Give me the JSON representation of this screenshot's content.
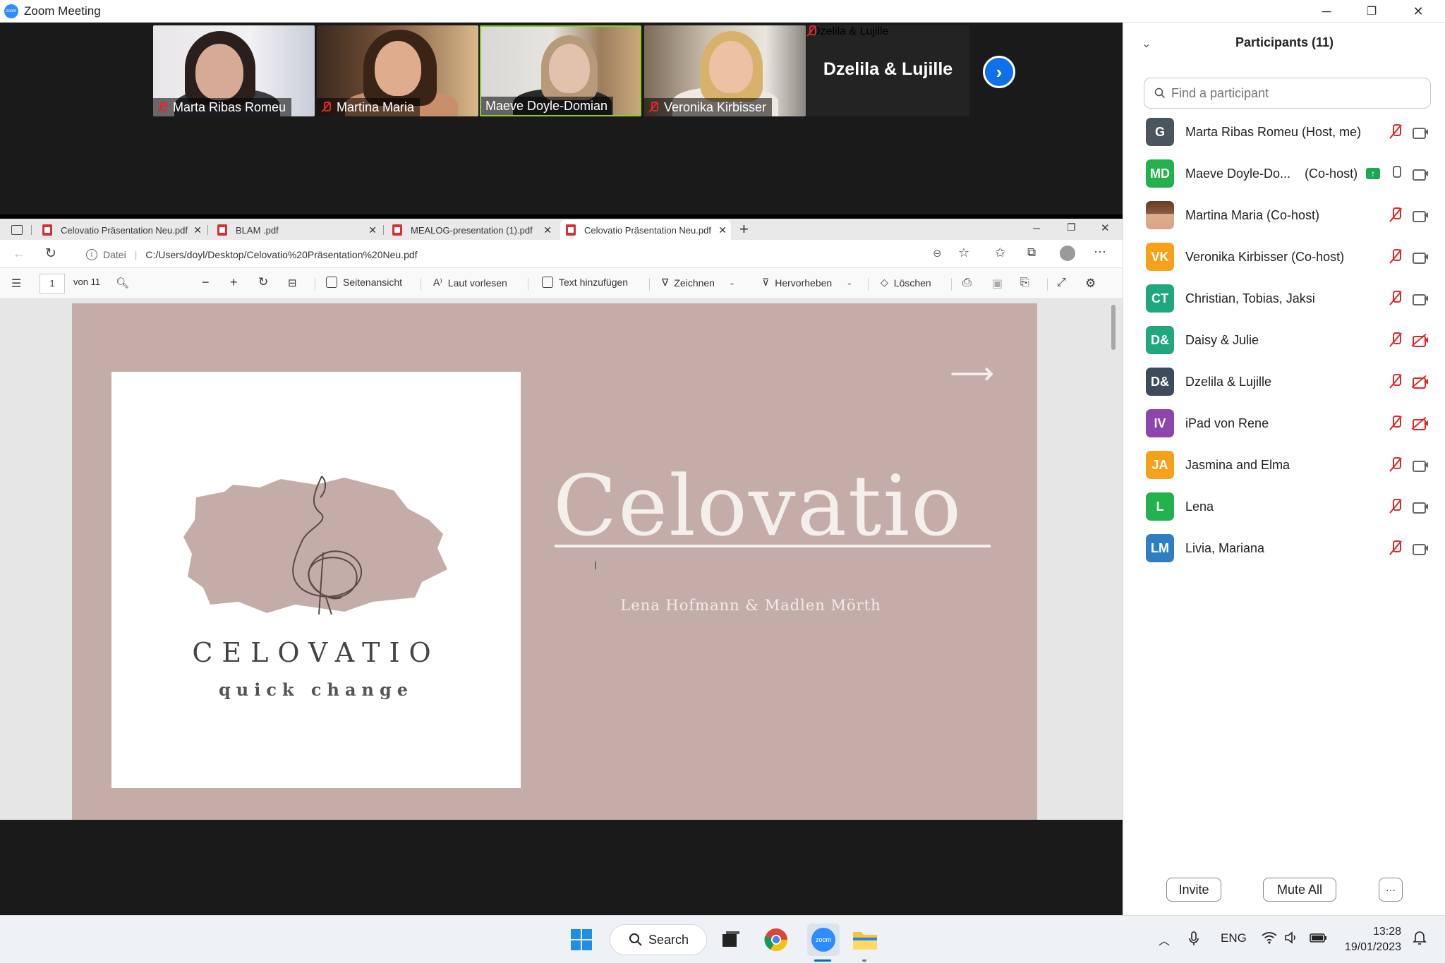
{
  "window": {
    "title": "Zoom Meeting",
    "controls": {
      "minimize": "─",
      "restore": "❐",
      "close": "✕"
    }
  },
  "video_tiles": [
    {
      "name": "Marta Ribas Romeu",
      "muted": true
    },
    {
      "name": "Martina Maria",
      "muted": true
    },
    {
      "name": "Maeve Doyle-Domian",
      "muted": false,
      "active_speaker": true
    },
    {
      "name": "Veronika Kirbisser",
      "muted": true
    },
    {
      "name": "Dzelila & Lujille",
      "muted": true,
      "video_off": true,
      "big_label": "Dzelila & Lujille"
    }
  ],
  "browser": {
    "tabs": [
      {
        "label": "Celovatio Präsentation Neu.pdf"
      },
      {
        "label": "BLAM .pdf"
      },
      {
        "label": "MEALOG-presentation (1).pdf"
      },
      {
        "label": "Celovatio Präsentation Neu.pdf",
        "active": true
      }
    ],
    "new_tab": "+",
    "address": {
      "info_label": "Datei",
      "url": "C:/Users/doyl/Desktop/Celovatio%20Präsentation%20Neu.pdf"
    },
    "pdf_toolbar": {
      "page_current": "1",
      "page_total": "von 11",
      "page_view": "Seitenansicht",
      "read_aloud": "Laut vorlesen",
      "add_text": "Text hinzufügen",
      "draw": "Zeichnen",
      "highlight": "Hervorheben",
      "erase": "Löschen"
    }
  },
  "slide": {
    "logo_word": "CELOVATIO",
    "logo_tagline": "quick change",
    "title": "Celovatio",
    "subtitle": "Lena Hofmann & Madlen Mörth",
    "arrow": "⟶",
    "colors": {
      "background": "#c4ada8",
      "card": "#ffffff",
      "brush": "#c4ada8",
      "title": "#f5efec"
    }
  },
  "participants": {
    "header": "Participants (11)",
    "search_placeholder": "Find a participant",
    "list": [
      {
        "initials": "G",
        "color": "#4a5560",
        "name": "Marta Ribas Romeu (Host, me)",
        "mic": "muted",
        "cam": "on"
      },
      {
        "initials": "MD",
        "color": "#22b14c",
        "name": "Maeve Doyle-Do...    (Co-host)",
        "mic": "on",
        "cam": "on",
        "sharing": true
      },
      {
        "initials": "",
        "color": "#8a5a44",
        "name": "Martina Maria (Co-host)",
        "mic": "muted",
        "cam": "on",
        "photo": true
      },
      {
        "initials": "VK",
        "color": "#f7a11a",
        "name": "Veronika Kirbisser (Co-host)",
        "mic": "muted",
        "cam": "on"
      },
      {
        "initials": "CT",
        "color": "#1fa77f",
        "name": "Christian, Tobias, Jaksi",
        "mic": "muted",
        "cam": "on"
      },
      {
        "initials": "D&",
        "color": "#1fa77f",
        "name": "Daisy & Julie",
        "mic": "muted",
        "cam": "off"
      },
      {
        "initials": "D&",
        "color": "#3d4b5c",
        "name": "Dzelila & Lujille",
        "mic": "muted",
        "cam": "off"
      },
      {
        "initials": "IV",
        "color": "#8e44ad",
        "name": "iPad von Rene",
        "mic": "muted",
        "cam": "off"
      },
      {
        "initials": "JA",
        "color": "#f7a11a",
        "name": "Jasmina and Elma",
        "mic": "muted",
        "cam": "on"
      },
      {
        "initials": "L",
        "color": "#22b14c",
        "name": "Lena",
        "mic": "muted",
        "cam": "on"
      },
      {
        "initials": "LM",
        "color": "#2d7fc1",
        "name": "Livia, Mariana",
        "mic": "muted",
        "cam": "on"
      }
    ],
    "buttons": {
      "invite": "Invite",
      "mute_all": "Mute All",
      "more": "···"
    }
  },
  "taskbar": {
    "search_label": "Search",
    "lang": "ENG",
    "time": "13:28",
    "date": "19/01/2023",
    "apps": [
      "windows-start",
      "search",
      "file-manager",
      "chrome",
      "zoom",
      "file-explorer"
    ]
  }
}
